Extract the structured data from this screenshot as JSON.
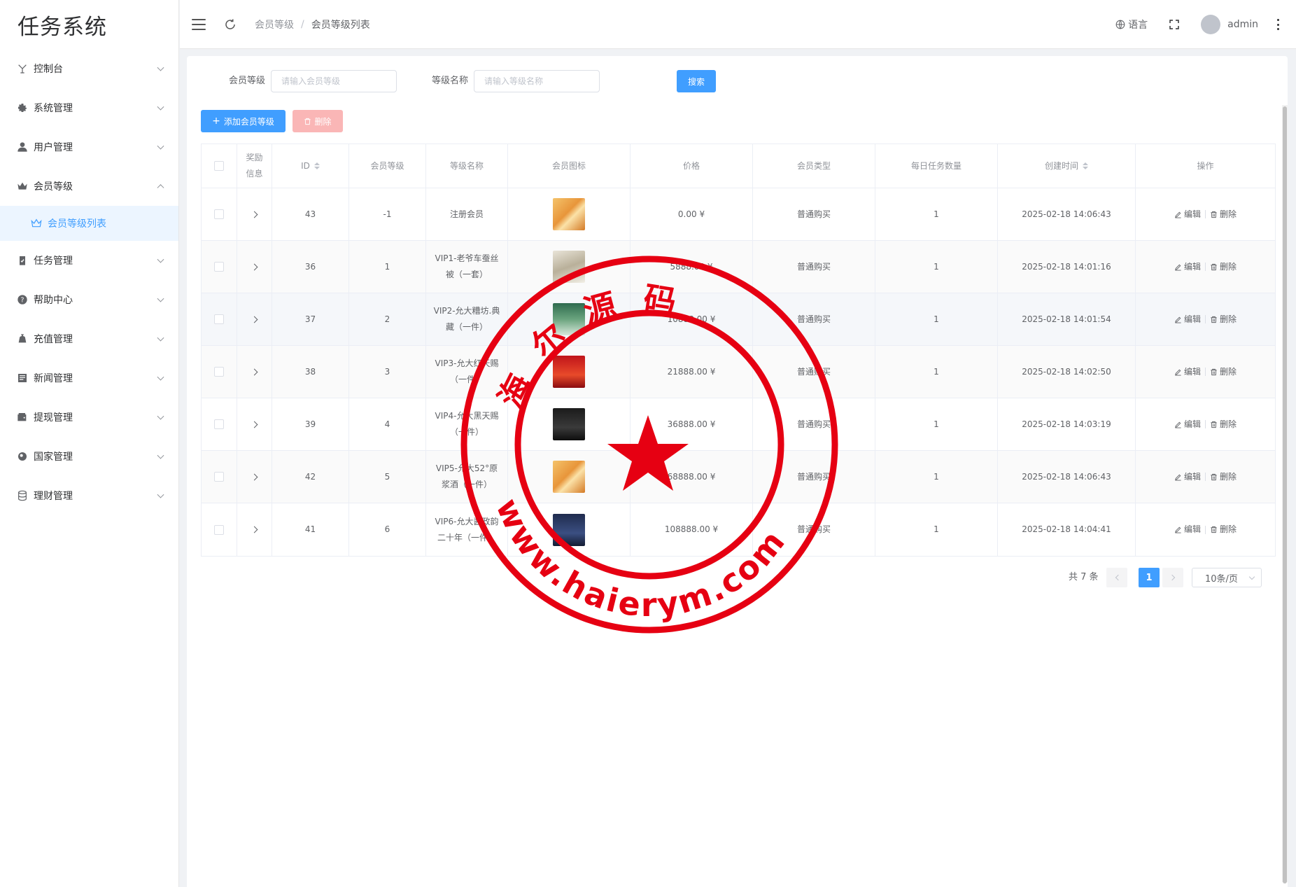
{
  "app": {
    "title": "任务系统"
  },
  "sidebar": {
    "items": [
      {
        "label": "控制台",
        "icon": "dashboard-icon",
        "expanded": false
      },
      {
        "label": "系统管理",
        "icon": "gear-icon",
        "expanded": false
      },
      {
        "label": "用户管理",
        "icon": "user-icon",
        "expanded": false
      },
      {
        "label": "会员等级",
        "icon": "crown-icon",
        "expanded": true
      },
      {
        "label": "任务管理",
        "icon": "clipboard-icon",
        "expanded": false
      },
      {
        "label": "帮助中心",
        "icon": "help-icon",
        "expanded": false
      },
      {
        "label": "充值管理",
        "icon": "money-bag-icon",
        "expanded": false
      },
      {
        "label": "新闻管理",
        "icon": "news-icon",
        "expanded": false
      },
      {
        "label": "提现管理",
        "icon": "wallet-icon",
        "expanded": false
      },
      {
        "label": "国家管理",
        "icon": "globe-icon",
        "expanded": false
      },
      {
        "label": "理财管理",
        "icon": "database-icon",
        "expanded": false
      }
    ],
    "subitem": {
      "label": "会员等级列表",
      "icon": "crown-outline-icon"
    }
  },
  "header": {
    "breadcrumb": [
      "会员等级",
      "会员等级列表"
    ],
    "language_label": "语言",
    "username": "admin"
  },
  "search": {
    "level_label": "会员等级",
    "level_placeholder": "请输入会员等级",
    "name_label": "等级名称",
    "name_placeholder": "请输入等级名称",
    "search_button": "搜索"
  },
  "toolbar": {
    "add_label": "添加会员等级",
    "delete_label": "删除"
  },
  "table": {
    "columns": {
      "reward_info": "奖励信息",
      "id": "ID",
      "level": "会员等级",
      "name": "等级名称",
      "icon": "会员图标",
      "price": "价格",
      "type": "会员类型",
      "daily_tasks": "每日任务数量",
      "created": "创建时间",
      "actions": "操作"
    },
    "edit_label": "编辑",
    "delete_label": "删除",
    "rows": [
      {
        "id": "43",
        "level": "-1",
        "name": "注册会员",
        "price": "0.00 ¥",
        "type": "普通购买",
        "daily": "1",
        "created": "2025-02-18 14:06:43",
        "img": "gift-box"
      },
      {
        "id": "36",
        "level": "1",
        "name": "VIP1-老爷车蚕丝被（一套）",
        "price": "5888.00 ¥",
        "type": "普通购买",
        "daily": "1",
        "created": "2025-02-18 14:01:16",
        "img": "quilt"
      },
      {
        "id": "37",
        "level": "2",
        "name": "VIP2-允大糟坊.典藏（一件）",
        "price": "10888.00 ¥",
        "type": "普通购买",
        "daily": "1",
        "created": "2025-02-18 14:01:54",
        "img": "green-box"
      },
      {
        "id": "38",
        "level": "3",
        "name": "VIP3-允大红天赐（一件）",
        "price": "21888.00 ¥",
        "type": "普通购买",
        "daily": "1",
        "created": "2025-02-18 14:02:50",
        "img": "red-box"
      },
      {
        "id": "39",
        "level": "4",
        "name": "VIP4-允大黑天赐（一件）",
        "price": "36888.00 ¥",
        "type": "普通购买",
        "daily": "1",
        "created": "2025-02-18 14:03:19",
        "img": "black-box"
      },
      {
        "id": "42",
        "level": "5",
        "name": "VIP5-允大52°原浆酒（一件）",
        "price": "68888.00 ¥",
        "type": "普通购买",
        "daily": "1",
        "created": "2025-02-18 14:06:43",
        "img": "gift-box"
      },
      {
        "id": "41",
        "level": "6",
        "name": "VIP6-允大酱政韵二十年（一件）",
        "price": "108888.00 ¥",
        "type": "普通购买",
        "daily": "1",
        "created": "2025-02-18 14:04:41",
        "img": "navy-box"
      }
    ]
  },
  "pagination": {
    "total_label": "共 7 条",
    "current_page": "1",
    "page_size": "10条/页"
  },
  "watermark": {
    "top_text": "海尔源码",
    "bottom_text": "www.haierym.com",
    "color": "#e60012"
  }
}
